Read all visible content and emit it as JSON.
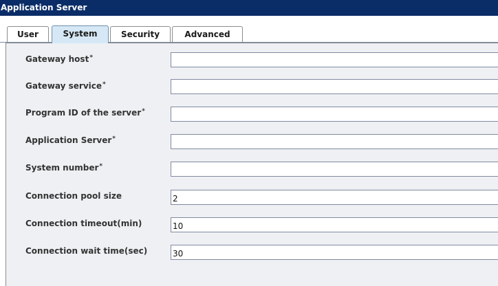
{
  "window": {
    "title": "Application Server"
  },
  "tabs": [
    {
      "label": "User"
    },
    {
      "label": "System",
      "active": true
    },
    {
      "label": "Security"
    },
    {
      "label": "Advanced"
    }
  ],
  "form": {
    "fields": [
      {
        "label": "Gateway host",
        "required": "*",
        "value": ""
      },
      {
        "label": "Gateway service",
        "required": "*",
        "value": ""
      },
      {
        "label": "Program ID of the server",
        "required": "*",
        "value": ""
      },
      {
        "label": "Application Server",
        "required": "*",
        "value": ""
      },
      {
        "label": "System number",
        "required": "*",
        "value": ""
      },
      {
        "label": "Connection pool size",
        "required": "",
        "value": "2"
      },
      {
        "label": "Connection timeout(min)",
        "required": "",
        "value": "10"
      },
      {
        "label": "Connection wait time(sec)",
        "required": "",
        "value": "30"
      }
    ]
  },
  "colors": {
    "titlebar": "#0b2d67",
    "active_tab": "#d6e8f5",
    "panel": "#eef0f3"
  }
}
